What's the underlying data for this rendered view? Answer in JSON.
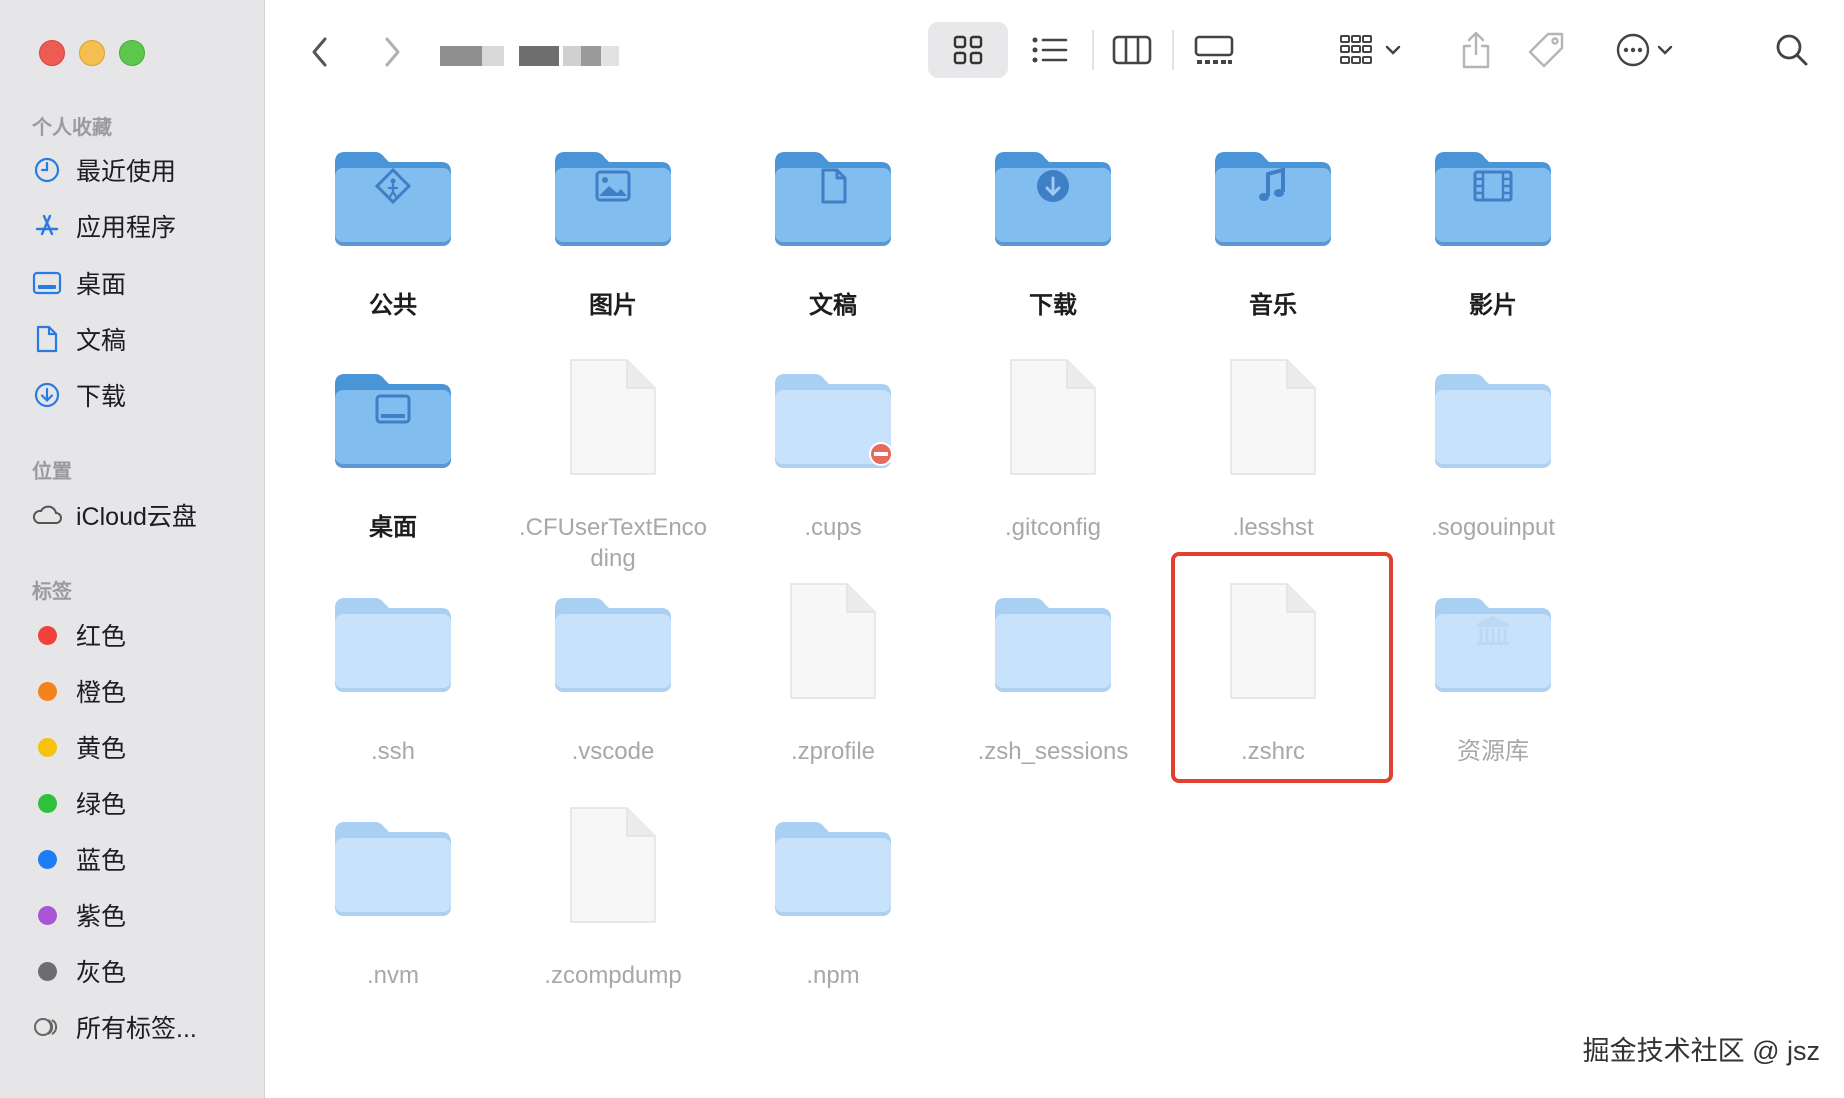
{
  "sidebar": {
    "favorites_title": "个人收藏",
    "favorites": [
      {
        "label": "最近使用",
        "icon": "clock-icon"
      },
      {
        "label": "应用程序",
        "icon": "apps-icon"
      },
      {
        "label": "桌面",
        "icon": "desktop-icon"
      },
      {
        "label": "文稿",
        "icon": "document-icon"
      },
      {
        "label": "下载",
        "icon": "download-icon"
      }
    ],
    "locations_title": "位置",
    "locations": [
      {
        "label": "iCloud云盘",
        "icon": "cloud-icon"
      }
    ],
    "tags_title": "标签",
    "tags": [
      {
        "label": "红色",
        "color": "#f0413a"
      },
      {
        "label": "橙色",
        "color": "#f5831b"
      },
      {
        "label": "黄色",
        "color": "#f6c10f"
      },
      {
        "label": "绿色",
        "color": "#2fc03d"
      },
      {
        "label": "蓝色",
        "color": "#1e7cf6"
      },
      {
        "label": "紫色",
        "color": "#a855d6"
      },
      {
        "label": "灰色",
        "color": "#6d6d70"
      },
      {
        "label": "所有标签...",
        "icon": "all-tags-icon"
      }
    ]
  },
  "toolbar": {
    "back": "back-chevron-icon",
    "forward": "forward-chevron-icon",
    "view_icons": "icon-view-icon",
    "view_list": "list-view-icon",
    "view_columns": "column-view-icon",
    "view_gallery": "gallery-view-icon",
    "group": "group-icon",
    "share": "share-icon",
    "tag": "tag-icon",
    "more": "more-icon",
    "search": "search-icon"
  },
  "files": [
    {
      "name": "公共",
      "kind": "sys-folder",
      "glyph": "public-icon"
    },
    {
      "name": "图片",
      "kind": "sys-folder",
      "glyph": "picture-icon"
    },
    {
      "name": "文稿",
      "kind": "sys-folder",
      "glyph": "document-icon"
    },
    {
      "name": "下载",
      "kind": "sys-folder",
      "glyph": "download-icon"
    },
    {
      "name": "音乐",
      "kind": "sys-folder",
      "glyph": "music-icon"
    },
    {
      "name": "影片",
      "kind": "sys-folder",
      "glyph": "film-icon"
    },
    {
      "name": "桌面",
      "kind": "sys-folder",
      "glyph": "desktop-icon"
    },
    {
      "name": ".CFUserTextEncoding",
      "kind": "hidden-file"
    },
    {
      "name": ".cups",
      "kind": "hidden-folder",
      "badge": "no-entry-icon"
    },
    {
      "name": ".gitconfig",
      "kind": "hidden-file"
    },
    {
      "name": ".lesshst",
      "kind": "hidden-file"
    },
    {
      "name": ".sogouinput",
      "kind": "hidden-folder"
    },
    {
      "name": ".ssh",
      "kind": "hidden-folder"
    },
    {
      "name": ".vscode",
      "kind": "hidden-folder"
    },
    {
      "name": ".zprofile",
      "kind": "hidden-file"
    },
    {
      "name": ".zsh_sessions",
      "kind": "hidden-folder"
    },
    {
      "name": ".zshrc",
      "kind": "hidden-file",
      "highlighted": true
    },
    {
      "name": "资源库",
      "kind": "hidden-folder",
      "glyph": "library-icon"
    },
    {
      "name": ".nvm",
      "kind": "hidden-folder"
    },
    {
      "name": ".zcompdump",
      "kind": "hidden-file"
    },
    {
      "name": ".npm",
      "kind": "hidden-folder"
    }
  ],
  "watermark": "掘金技术社区 @ jsz"
}
